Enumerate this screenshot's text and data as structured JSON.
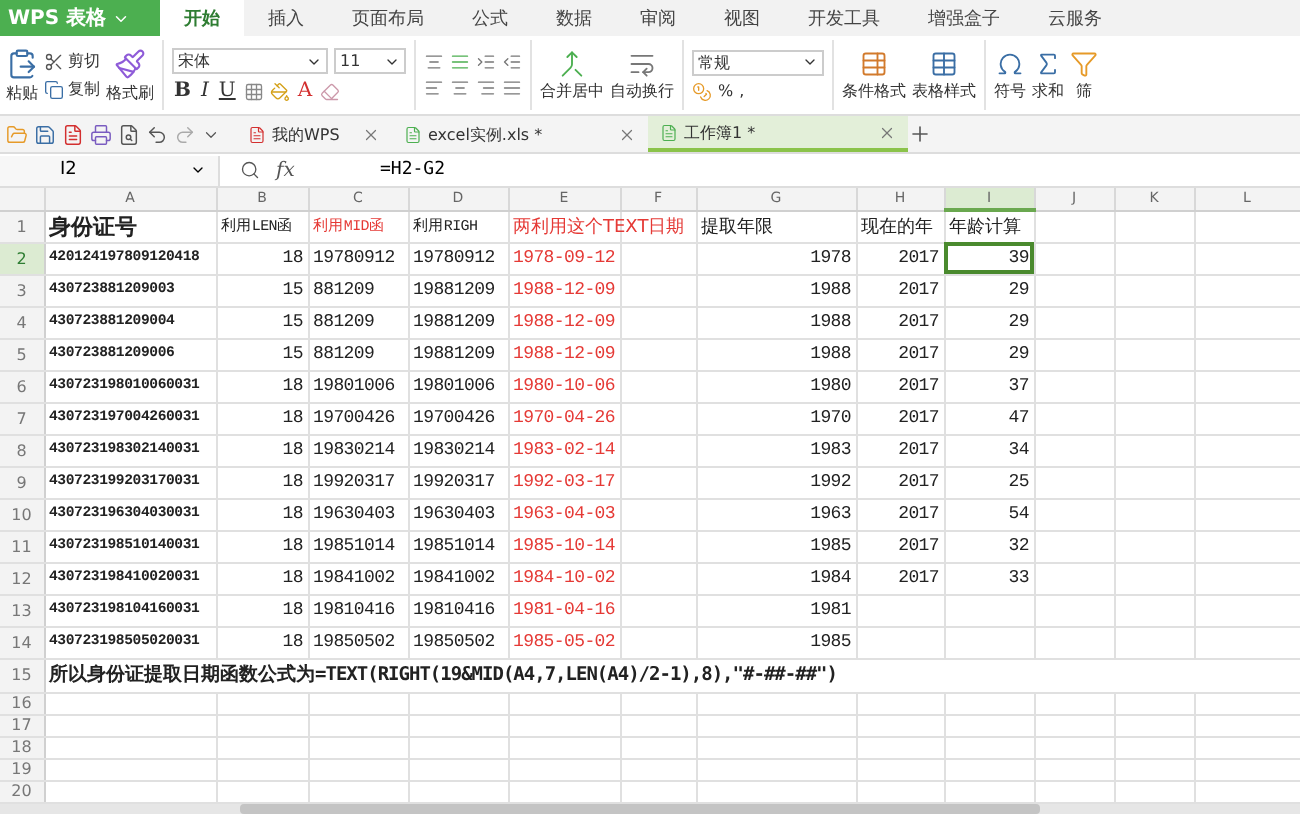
{
  "app": {
    "logo": "WPS 表格"
  },
  "menu_tabs": [
    {
      "label": "开始",
      "selected": true
    },
    {
      "label": "插入",
      "selected": false
    },
    {
      "label": "页面布局",
      "selected": false
    },
    {
      "label": "公式",
      "selected": false
    },
    {
      "label": "数据",
      "selected": false
    },
    {
      "label": "审阅",
      "selected": false
    },
    {
      "label": "视图",
      "selected": false
    },
    {
      "label": "开发工具",
      "selected": false
    },
    {
      "label": "增强盒子",
      "selected": false
    },
    {
      "label": "云服务",
      "selected": false
    }
  ],
  "ribbon": {
    "paste": "粘贴",
    "cut": "剪切",
    "copy": "复制",
    "format_painter": "格式刷",
    "font_name": "宋体",
    "font_size": "11",
    "bold": "B",
    "italic": "I",
    "underline": "U",
    "font_color": "A",
    "merge": "合并居中",
    "wrap": "自动换行",
    "number_format": "常规",
    "percent": "%",
    "thousands": ",",
    "conditional": "条件格式",
    "table_style": "表格样式",
    "symbol": "符号",
    "sum": "求和",
    "filter": "筛"
  },
  "doc_tabs": [
    {
      "label": "我的WPS",
      "selected": false
    },
    {
      "label": "excel实例.xls *",
      "selected": false
    },
    {
      "label": "工作簿1 *",
      "selected": true
    }
  ],
  "formula_bar": {
    "name_box": "I2",
    "fx": "fx",
    "formula": "=H2-G2"
  },
  "table": {
    "columns": [
      {
        "letter": "A",
        "selected": false,
        "emphasis": false
      },
      {
        "letter": "B",
        "selected": false,
        "emphasis": false
      },
      {
        "letter": "C",
        "selected": false,
        "emphasis": false
      },
      {
        "letter": "D",
        "selected": false,
        "emphasis": false
      },
      {
        "letter": "E",
        "selected": false,
        "emphasis": true
      },
      {
        "letter": "F",
        "selected": false,
        "emphasis": false
      },
      {
        "letter": "G",
        "selected": false,
        "emphasis": false
      },
      {
        "letter": "H",
        "selected": false,
        "emphasis": false
      },
      {
        "letter": "I",
        "selected": true,
        "emphasis": false
      },
      {
        "letter": "J",
        "selected": false,
        "emphasis": false
      },
      {
        "letter": "K",
        "selected": false,
        "emphasis": false
      },
      {
        "letter": "L",
        "selected": false,
        "emphasis": false
      }
    ],
    "header_row": {
      "number": "1",
      "cells": [
        {
          "text": "身份证号",
          "emphasis": false
        },
        {
          "text": "利用LEN函",
          "emphasis": false
        },
        {
          "text": "利用MID函",
          "emphasis": true
        },
        {
          "text": "利用RIGH",
          "emphasis": false
        },
        {
          "text": "两利用这个TEXT日期",
          "emphasis": true
        },
        null,
        {
          "text": "提取年限",
          "emphasis": false
        },
        {
          "text": "现在的年",
          "emphasis": false
        },
        {
          "text": "年龄计算",
          "emphasis": false
        }
      ]
    },
    "rows": [
      {
        "number": "2",
        "selected": true,
        "cells": [
          "420124197809120418",
          "18",
          "19780912",
          "19780912",
          "1978-09-12",
          "",
          "1978",
          "2017",
          "39"
        ]
      },
      {
        "number": "3",
        "selected": false,
        "cells": [
          "430723881209003",
          "15",
          "881209",
          "19881209",
          "1988-12-09",
          "",
          "1988",
          "2017",
          "29"
        ]
      },
      {
        "number": "4",
        "selected": false,
        "cells": [
          "430723881209004",
          "15",
          "881209",
          "19881209",
          "1988-12-09",
          "",
          "1988",
          "2017",
          "29"
        ]
      },
      {
        "number": "5",
        "selected": false,
        "cells": [
          "430723881209006",
          "15",
          "881209",
          "19881209",
          "1988-12-09",
          "",
          "1988",
          "2017",
          "29"
        ]
      },
      {
        "number": "6",
        "selected": false,
        "cells": [
          "430723198010060031",
          "18",
          "19801006",
          "19801006",
          "1980-10-06",
          "",
          "1980",
          "2017",
          "37"
        ]
      },
      {
        "number": "7",
        "selected": false,
        "cells": [
          "430723197004260031",
          "18",
          "19700426",
          "19700426",
          "1970-04-26",
          "",
          "1970",
          "2017",
          "47"
        ]
      },
      {
        "number": "8",
        "selected": false,
        "cells": [
          "430723198302140031",
          "18",
          "19830214",
          "19830214",
          "1983-02-14",
          "",
          "1983",
          "2017",
          "34"
        ]
      },
      {
        "number": "9",
        "selected": false,
        "cells": [
          "430723199203170031",
          "18",
          "19920317",
          "19920317",
          "1992-03-17",
          "",
          "1992",
          "2017",
          "25"
        ]
      },
      {
        "number": "10",
        "selected": false,
        "cells": [
          "430723196304030031",
          "18",
          "19630403",
          "19630403",
          "1963-04-03",
          "",
          "1963",
          "2017",
          "54"
        ]
      },
      {
        "number": "11",
        "selected": false,
        "cells": [
          "430723198510140031",
          "18",
          "19851014",
          "19851014",
          "1985-10-14",
          "",
          "1985",
          "2017",
          "32"
        ]
      },
      {
        "number": "12",
        "selected": false,
        "cells": [
          "430723198410020031",
          "18",
          "19841002",
          "19841002",
          "1984-10-02",
          "",
          "1984",
          "2017",
          "33"
        ]
      },
      {
        "number": "13",
        "selected": false,
        "cells": [
          "430723198104160031",
          "18",
          "19810416",
          "19810416",
          "1981-04-16",
          "",
          "1981",
          "",
          ""
        ]
      },
      {
        "number": "14",
        "selected": false,
        "cells": [
          "430723198505020031",
          "18",
          "19850502",
          "19850502",
          "1985-05-02",
          "",
          "1985",
          "",
          ""
        ]
      }
    ],
    "note_row": {
      "number": "15",
      "text": "所以身份证提取日期函数公式为=TEXT(RIGHT(19&MID(A4,7,LEN(A4)/2-1),8),\"#-##-##\")"
    },
    "empty_rows": [
      "16",
      "17",
      "18",
      "19",
      "20"
    ]
  }
}
